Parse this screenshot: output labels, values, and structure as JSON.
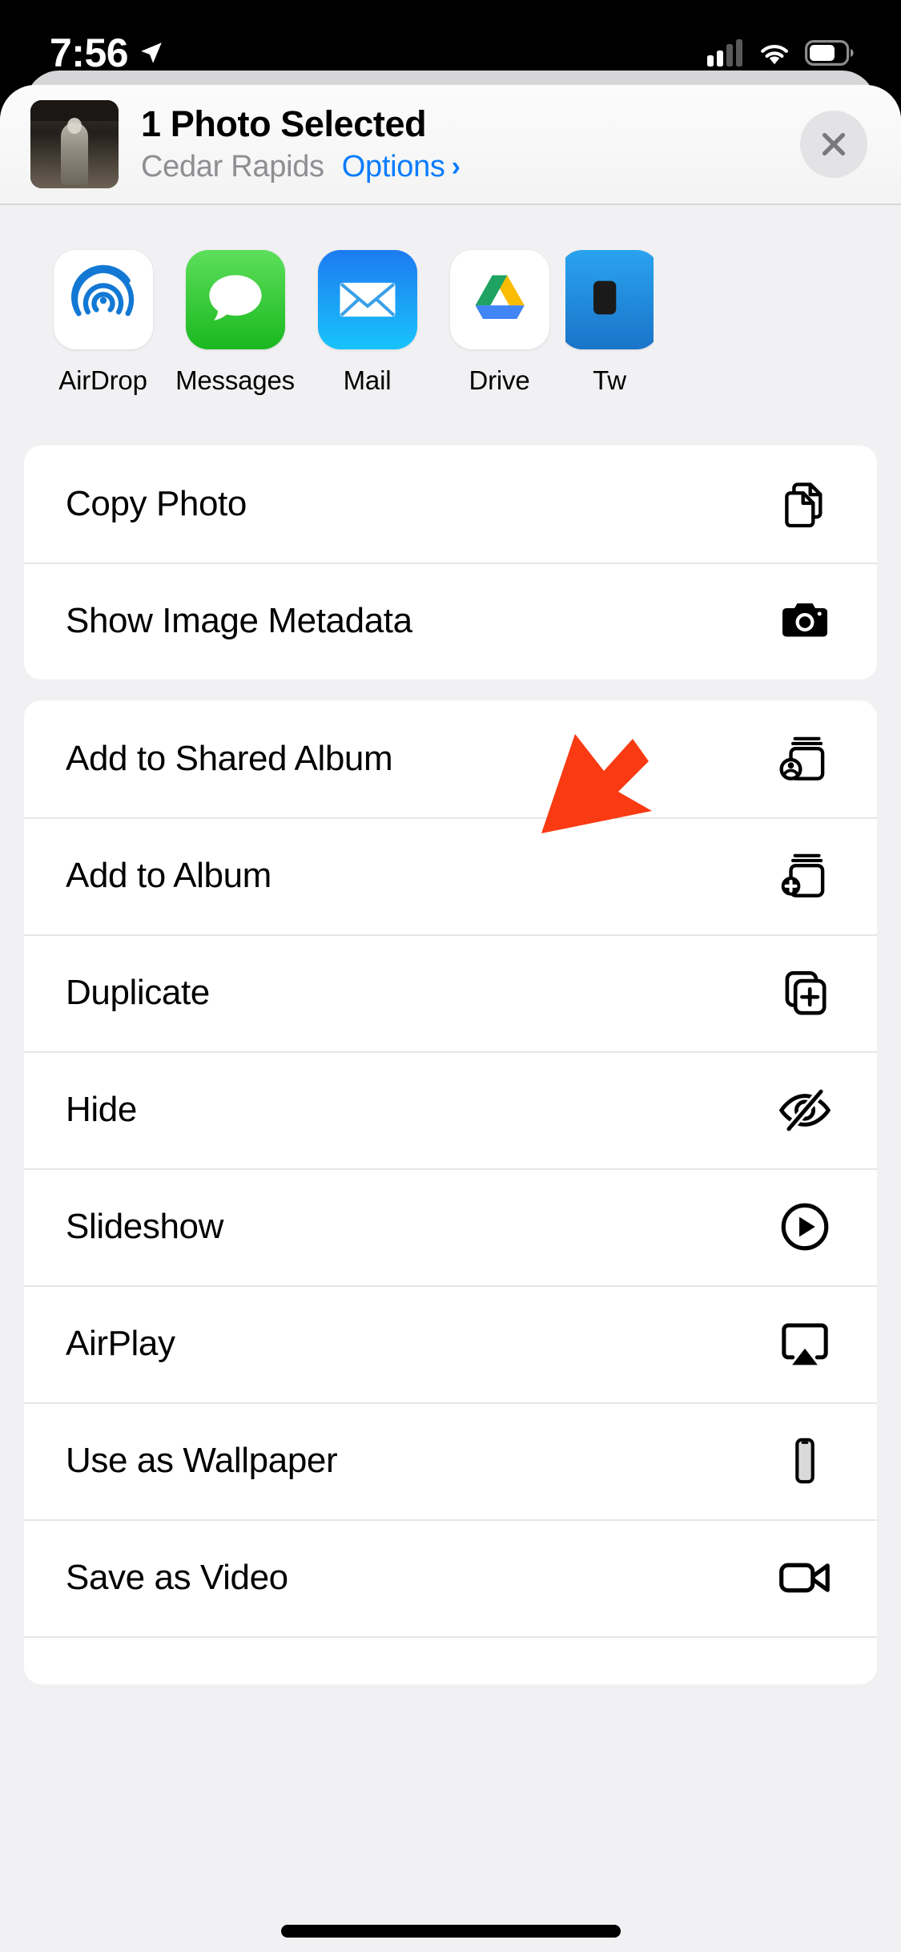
{
  "status_bar": {
    "time": "7:56",
    "location_arrow_icon": "location-arrow-icon",
    "cellular_icon": "cellular-signal-icon",
    "wifi_icon": "wifi-icon",
    "battery_icon": "battery-icon"
  },
  "share_sheet": {
    "header": {
      "title": "1 Photo Selected",
      "location": "Cedar Rapids",
      "options_label": "Options",
      "options_chevron": "›",
      "close_icon": "close-icon",
      "thumbnail_icon": "photo-thumbnail"
    },
    "apps": [
      {
        "label": "AirDrop",
        "icon": "airdrop-icon"
      },
      {
        "label": "Messages",
        "icon": "messages-icon"
      },
      {
        "label": "Mail",
        "icon": "mail-icon"
      },
      {
        "label": "Drive",
        "icon": "google-drive-icon"
      },
      {
        "label": "Tw",
        "icon": "twitter-icon"
      }
    ],
    "action_groups": [
      {
        "rows": [
          {
            "label": "Copy Photo",
            "icon": "copy-documents-icon"
          },
          {
            "label": "Show Image Metadata",
            "icon": "camera-icon"
          }
        ]
      },
      {
        "rows": [
          {
            "label": "Add to Shared Album",
            "icon": "shared-album-person-icon"
          },
          {
            "label": "Add to Album",
            "icon": "add-album-plus-icon"
          },
          {
            "label": "Duplicate",
            "icon": "duplicate-squares-plus-icon"
          },
          {
            "label": "Hide",
            "icon": "eye-slash-icon"
          },
          {
            "label": "Slideshow",
            "icon": "play-circle-icon"
          },
          {
            "label": "AirPlay",
            "icon": "airplay-icon"
          },
          {
            "label": "Use as Wallpaper",
            "icon": "iphone-icon"
          },
          {
            "label": "Save as Video",
            "icon": "video-camera-icon"
          },
          {
            "label": "",
            "icon": "clipped-row-icon"
          }
        ]
      }
    ],
    "annotation": {
      "type": "arrow",
      "color": "#F93A12",
      "points_at": "Show Image Metadata"
    },
    "colors": {
      "accent_blue": "#0A7CFF",
      "sheet_background": "#F1F1F3",
      "card_background": "#FFFFFF",
      "secondary_text": "#8E8E93",
      "separator": "#E6E6E8",
      "arrow_red": "#F93A12"
    }
  },
  "home_indicator": "home-indicator"
}
